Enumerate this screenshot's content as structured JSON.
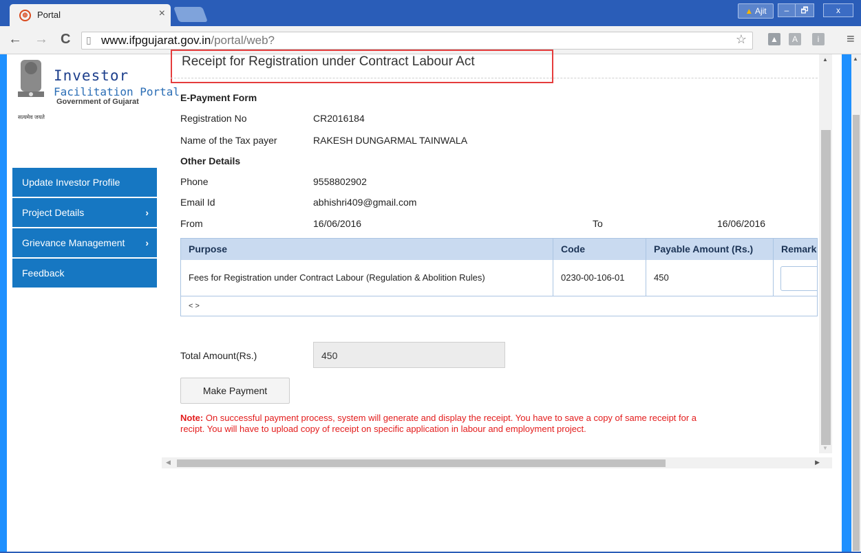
{
  "browser": {
    "tab_title": "Portal",
    "tab_close": "×",
    "favicon_glyph": "⊕",
    "user_badge": "Ajit",
    "url_host": "www.ifpgujarat.gov.in",
    "url_path": "/portal/web?",
    "back": "←",
    "forward": "→",
    "reload": "C",
    "star": "☆",
    "menu": "≡",
    "win_min": "–",
    "win_max": "🗗",
    "win_close": "x",
    "ext_icons": [
      "drive-icon",
      "a-icon",
      "i-icon"
    ]
  },
  "logo": {
    "line1": "Investor",
    "line2": "Facilitation Portal",
    "line3": "Government of Gujarat",
    "motto": "सत्यमेव जयते"
  },
  "sidebar": {
    "items": [
      {
        "label": "Update Investor Profile",
        "chevron": ""
      },
      {
        "label": "Project Details",
        "chevron": "›"
      },
      {
        "label": "Grievance Management",
        "chevron": "›"
      },
      {
        "label": "Feedback",
        "chevron": ""
      }
    ]
  },
  "form": {
    "title": "Receipt for Registration under Contract Labour Act",
    "section1": "E-Payment Form",
    "reg_no_label": "Registration No",
    "reg_no": "CR2016184",
    "taxpayer_label": "Name of the Tax payer",
    "taxpayer": "RAKESH DUNGARMAL TAINWALA",
    "section2": "Other Details",
    "phone_label": "Phone",
    "phone": "9558802902",
    "email_label": "Email Id",
    "email": "abhishri409@gmail.com",
    "from_label": "From",
    "from": "16/06/2016",
    "to_label": "To",
    "to": "16/06/2016"
  },
  "table": {
    "headers": [
      "Purpose",
      "Code",
      "Payable Amount (Rs.)",
      "Remark"
    ],
    "rows": [
      {
        "purpose": "Fees for Registration under Contract Labour (Regulation & Abolition Rules)",
        "code": "0230-00-106-01",
        "amount": "450"
      }
    ],
    "pager": "< >"
  },
  "total": {
    "label": "Total Amount(Rs.)",
    "value": "450"
  },
  "pay_button": "Make Payment",
  "note": {
    "prefix": "Note:",
    "line1": " On successful payment process, system will generate and display the receipt. You have to save a copy of same receipt for a",
    "line2": "recipt. You will have to upload copy of receipt on specific application in labour and employment project."
  },
  "colors": {
    "sidebar": "#1677c2",
    "accent_blue": "#1e90ff",
    "note_red": "#e31b1b",
    "highlight": "#e53c3c"
  }
}
